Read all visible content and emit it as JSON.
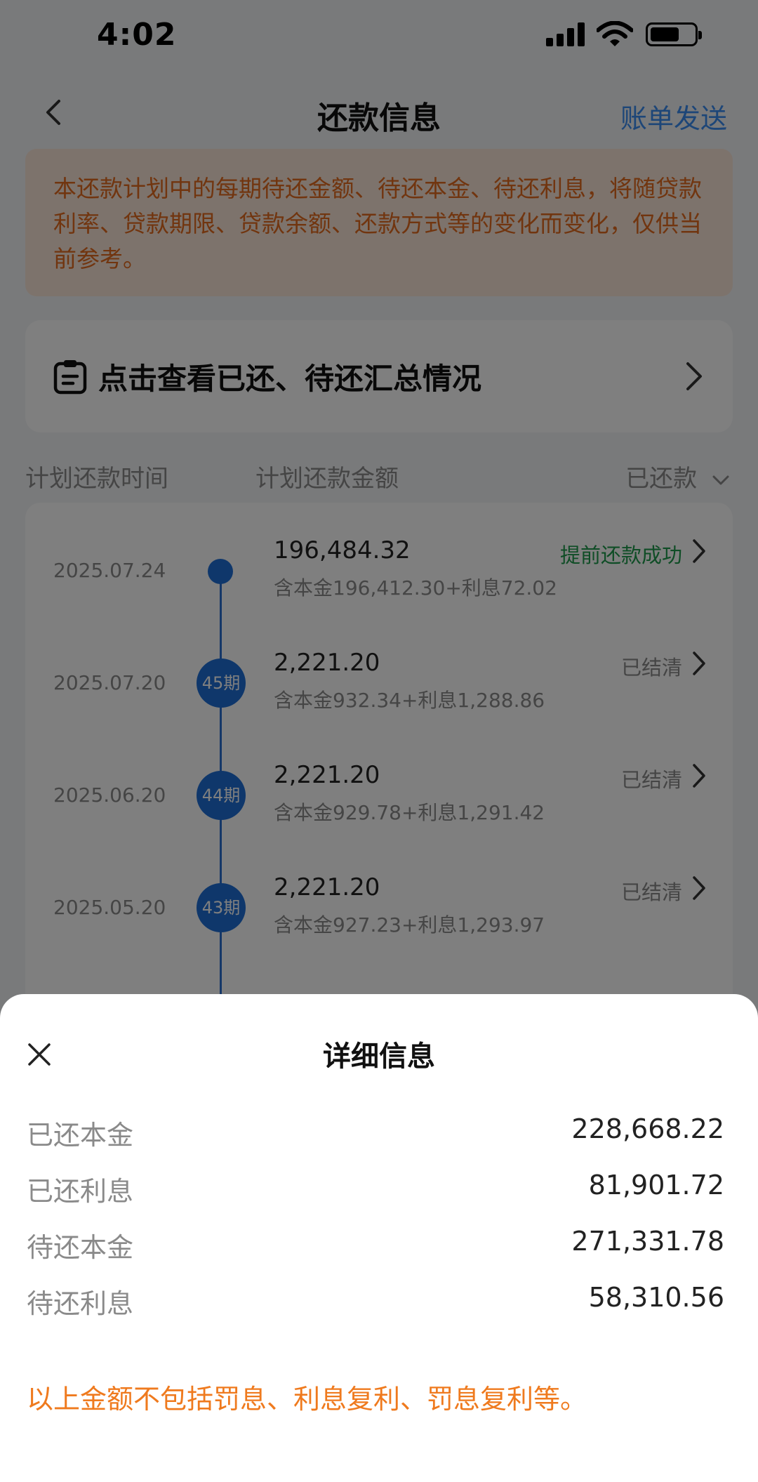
{
  "status_bar": {
    "time": "4:02"
  },
  "nav": {
    "title": "还款信息",
    "action": "账单发送"
  },
  "notice": "本还款计划中的每期待还金额、待还本金、待还利息，将随贷款利率、贷款期限、贷款余额、还款方式等的变化而变化，仅供当前参考。",
  "summary": {
    "label": "点击查看已还、待还汇总情况"
  },
  "columns": {
    "time": "计划还款时间",
    "amount": "计划还款金额",
    "filter": "已还款"
  },
  "schedule": [
    {
      "date": "2025.07.24",
      "badge": "",
      "amount": "196,484.32",
      "detail": "含本金196,412.30+利息72.02",
      "status": "提前还款成功",
      "status_color": "#1f9a4c"
    },
    {
      "date": "2025.07.20",
      "badge": "45期",
      "amount": "2,221.20",
      "detail": "含本金932.34+利息1,288.86",
      "status": "已结清",
      "status_color": "#8a8a8a"
    },
    {
      "date": "2025.06.20",
      "badge": "44期",
      "amount": "2,221.20",
      "detail": "含本金929.78+利息1,291.42",
      "status": "已结清",
      "status_color": "#8a8a8a"
    },
    {
      "date": "2025.05.20",
      "badge": "43期",
      "amount": "2,221.20",
      "detail": "含本金927.23+利息1,293.97",
      "status": "已结清",
      "status_color": "#8a8a8a"
    }
  ],
  "sheet": {
    "title": "详细信息",
    "rows": [
      {
        "label": "已还本金",
        "value": "228,668.22"
      },
      {
        "label": "已还利息",
        "value": "81,901.72"
      },
      {
        "label": "待还本金",
        "value": "271,331.78"
      },
      {
        "label": "待还利息",
        "value": "58,310.56"
      }
    ],
    "note": "以上金额不包括罚息、利息复利、罚息复利等。"
  },
  "colors": {
    "accent_blue": "#1f6fd6",
    "warning_orange": "#ef7a1e",
    "success_green": "#1f9a4c"
  }
}
